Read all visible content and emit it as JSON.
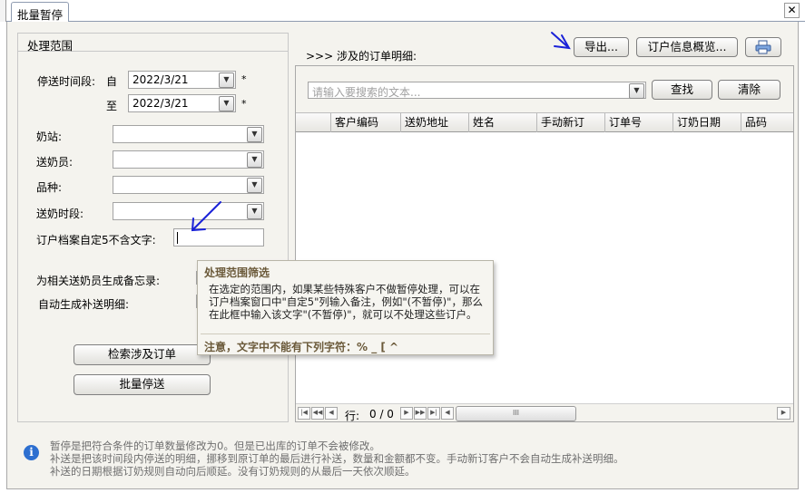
{
  "tab": {
    "title": "批量暂停",
    "close_glyph": "✕"
  },
  "scope": {
    "title": "处理范围",
    "date_label": "停送时间段:",
    "from_label": "自",
    "to_label": "至",
    "from_value": "2022/3/21",
    "to_value": "2022/3/21",
    "required_mark": "*",
    "station_label": "奶站:",
    "deliverer_label": "送奶员:",
    "variety_label": "品种:",
    "timeslot_label": "送奶时段:",
    "exclude_label": "订户档案自定5不含文字:",
    "exclude_value": "",
    "memo_label": "为相关送奶员生成备忘录:",
    "auto_label": "自动生成补送明细:",
    "search_button": "检索涉及订单",
    "batch_button": "批量停送"
  },
  "detail": {
    "title": ">>> 涉及的订单明细:",
    "export_button": "导出...",
    "overview_button": "订户信息概览...",
    "search_placeholder": "请输入要搜索的文本...",
    "find_button": "查找",
    "clear_button": "清除",
    "columns": [
      "客户编码",
      "送奶地址",
      "姓名",
      "手动新订",
      "订单号",
      "订奶日期",
      "品码"
    ],
    "row_label": "行:",
    "row_value": "0 / 0",
    "scroll_grip": "III"
  },
  "tooltip": {
    "title": "处理范围筛选",
    "body": "在选定的范围内，如果某些特殊客户不做暂停处理，可以在订户档案窗口中\"自定5\"列输入备注，例如\"(不暂停)\"，那么在此框中输入该文字\"(不暂停)\"，就可以不处理这些订户。",
    "note": "注意，文字中不能有下列字符：% _ [ ^"
  },
  "info": {
    "line1": "暂停是把符合条件的订单数量修改为0。但是已出库的订单不会被修改。",
    "line2": "补送是把该时间段内停送的明细，挪移到原订单的最后进行补送，数量和金额都不变。手动新订客户不会自动生成补送明细。",
    "line3": "补送的日期根据订奶规则自动向后顺延。没有订奶规则的从最后一天依次顺延。"
  },
  "colors": {
    "panel": "#f4f3ee",
    "annotation": "#1a22d8",
    "info_icon": "#2d6fd0",
    "tooltip_title": "#6b5a3a"
  }
}
